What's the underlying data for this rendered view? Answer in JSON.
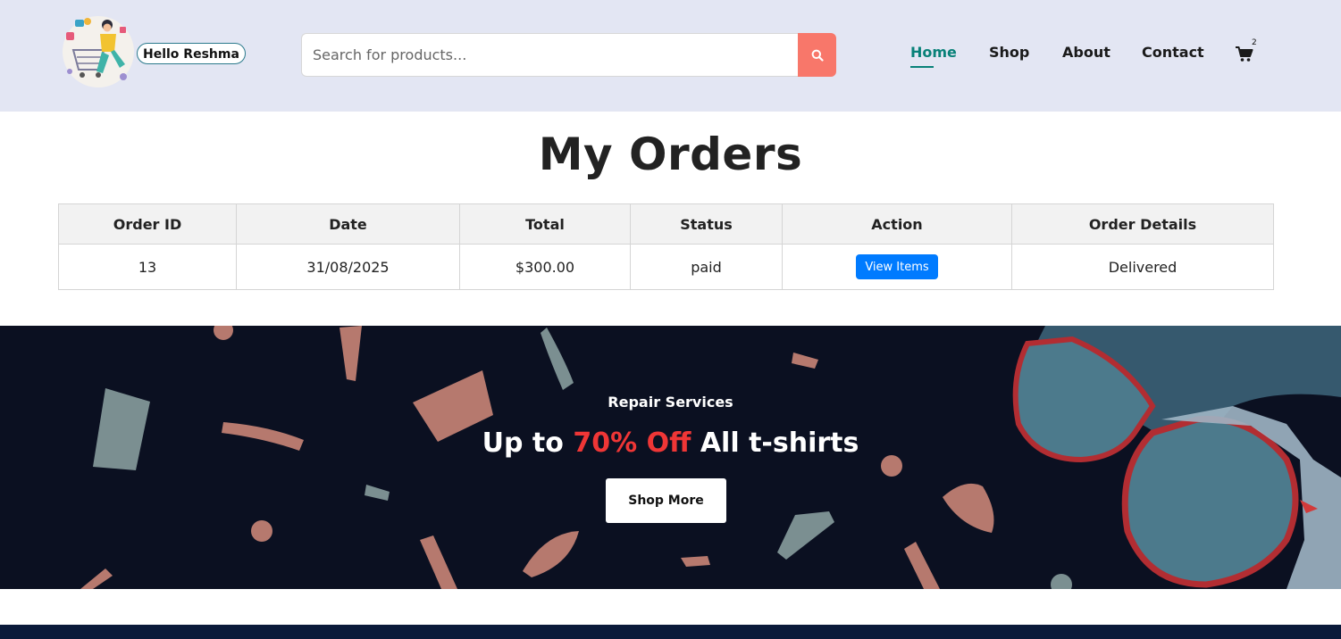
{
  "header": {
    "greeting": "Hello Reshma",
    "search": {
      "placeholder": "Search for products...",
      "value": ""
    },
    "nav": [
      {
        "label": "Home",
        "active": true
      },
      {
        "label": "Shop",
        "active": false
      },
      {
        "label": "About",
        "active": false
      },
      {
        "label": "Contact",
        "active": false
      }
    ],
    "cart_count": "2"
  },
  "orders": {
    "title": "My Orders",
    "columns": [
      "Order ID",
      "Date",
      "Total",
      "Status",
      "Action",
      "Order Details"
    ],
    "rows": [
      {
        "id": "13",
        "date": "31/08/2025",
        "total": "$300.00",
        "status": "paid",
        "action": "View Items",
        "details": "Delivered"
      }
    ]
  },
  "banner": {
    "subtitle": "Repair Services",
    "headline_pre": "Up to",
    "headline_highlight": "70% Off",
    "headline_post": "All t-shirts",
    "button": "Shop More"
  },
  "colors": {
    "header_bg": "#e3e6f3",
    "accent": "#088178",
    "search_button": "#f8776a",
    "view_button": "#007bff",
    "banner_bg": "#0b1021",
    "highlight": "#ef3636"
  },
  "icons": [
    "shopper-logo",
    "search-icon",
    "cart-icon",
    "sunglasses-image"
  ]
}
